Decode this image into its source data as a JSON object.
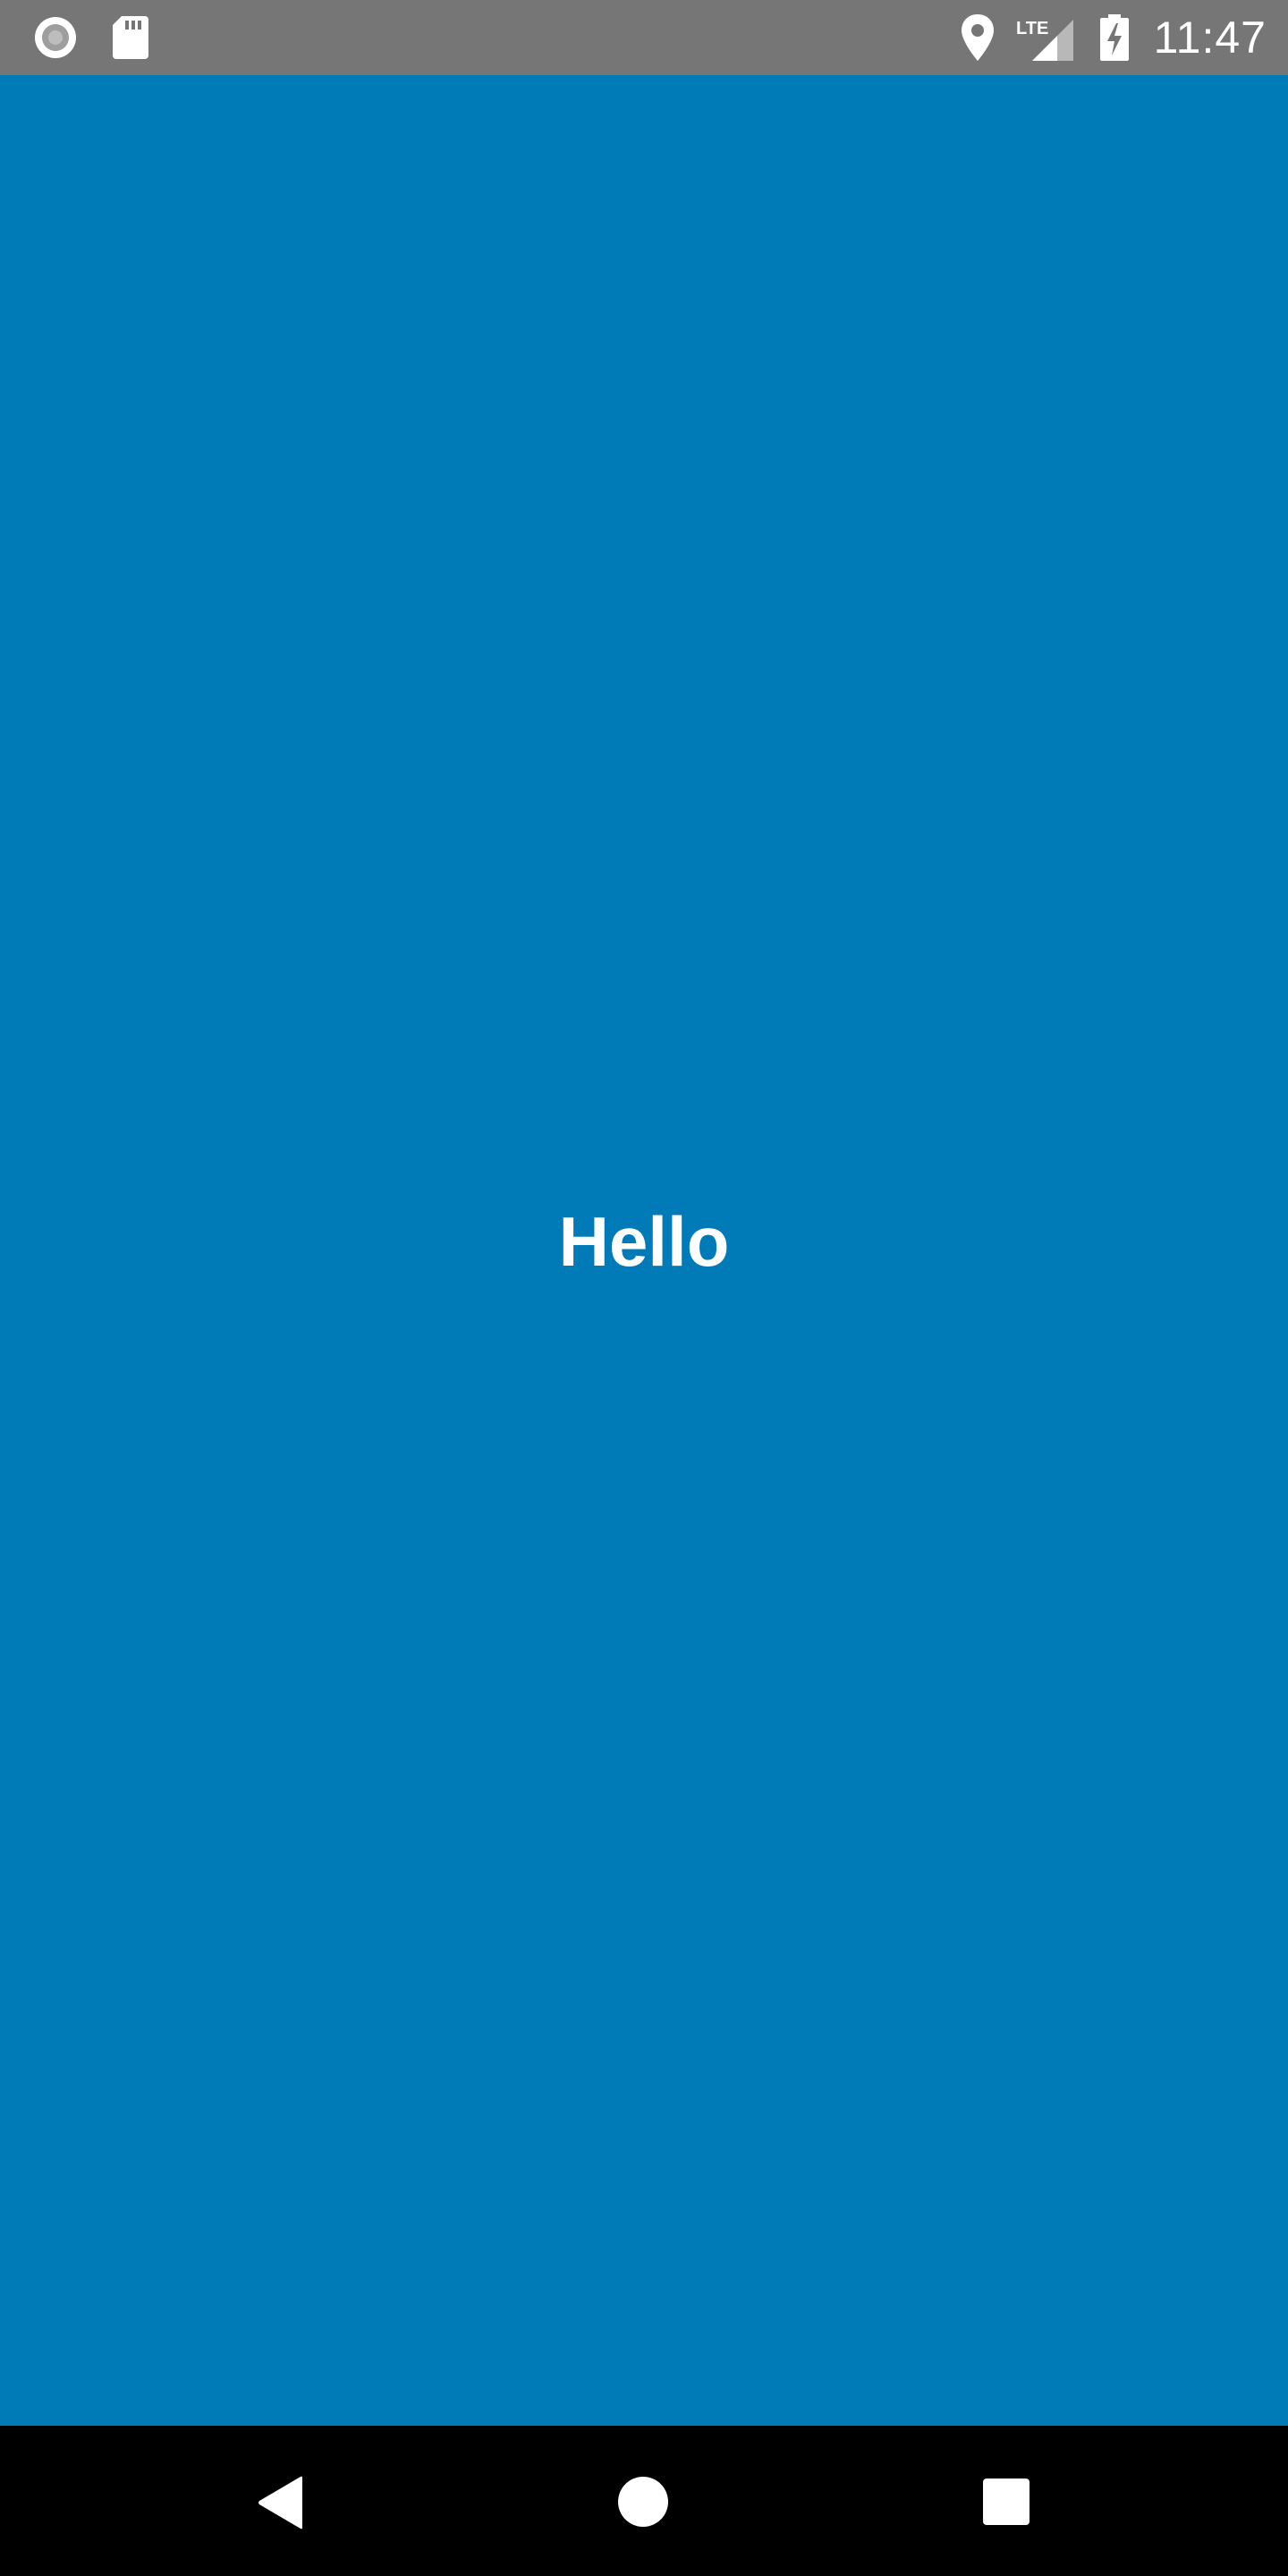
{
  "status_bar": {
    "time": "11:47",
    "network_label": "LTE",
    "icons": {
      "left": [
        "record-icon",
        "sd-card-icon"
      ],
      "right": [
        "location-icon",
        "lte-signal-icon",
        "battery-charging-icon"
      ]
    }
  },
  "main": {
    "text": "Hello"
  },
  "nav_bar": {
    "buttons": [
      "back-button",
      "home-button",
      "recents-button"
    ]
  },
  "colors": {
    "background": "#007bb8",
    "status_bar": "#767676",
    "nav_bar": "#000000",
    "text": "#ffffff"
  }
}
